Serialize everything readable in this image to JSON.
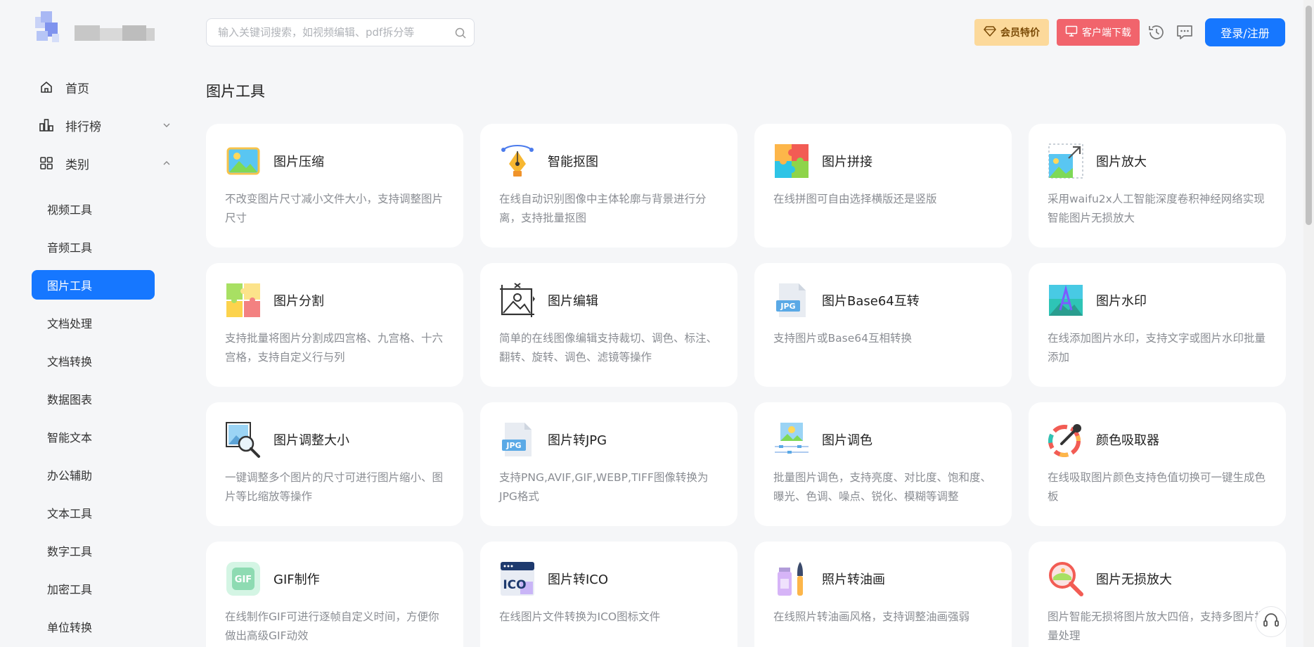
{
  "sidebar": {
    "nav": [
      {
        "label": "首页",
        "icon": "home-icon"
      },
      {
        "label": "排行榜",
        "icon": "ranking-icon"
      },
      {
        "label": "类别",
        "icon": "category-icon"
      }
    ],
    "categories": [
      "视频工具",
      "音频工具",
      "图片工具",
      "文档处理",
      "文档转换",
      "数据图表",
      "智能文本",
      "办公辅助",
      "文本工具",
      "数字工具",
      "加密工具",
      "单位转换"
    ],
    "active_category": "图片工具"
  },
  "header": {
    "search_placeholder": "输入关键词搜索，如视频编辑、pdf拆分等",
    "vip_label": "会员特价",
    "client_label": "客户端下载",
    "login_label": "登录/注册"
  },
  "page_title": "图片工具",
  "tools": [
    {
      "title": "图片压缩",
      "desc": "不改变图片尺寸减小文件大小，支持调整图片尺寸",
      "icon": "image-compress-icon"
    },
    {
      "title": "智能抠图",
      "desc": "在线自动识别图像中主体轮廓与背景进行分离，支持批量抠图",
      "icon": "pen-tool-icon"
    },
    {
      "title": "图片拼接",
      "desc": "在线拼图可自由选择横版还是竖版",
      "icon": "puzzle-icon"
    },
    {
      "title": "图片放大",
      "desc": "采用waifu2x人工智能深度卷积神经网络实现智能图片无损放大",
      "icon": "image-enlarge-icon"
    },
    {
      "title": "图片分割",
      "desc": "支持批量将图片分割成四宫格、九宫格、十六宫格，支持自定义行与列",
      "icon": "image-split-icon"
    },
    {
      "title": "图片编辑",
      "desc": "简单的在线图像编辑支持裁切、调色、标注、翻转、旋转、调色、滤镜等操作",
      "icon": "image-edit-icon"
    },
    {
      "title": "图片Base64互转",
      "desc": "支持图片或Base64互相转换",
      "icon": "jpg-file-icon"
    },
    {
      "title": "图片水印",
      "desc": "在线添加图片水印，支持文字或图片水印批量添加",
      "icon": "watermark-icon"
    },
    {
      "title": "图片调整大小",
      "desc": "一键调整多个图片的尺寸可进行图片缩小、图片等比缩放等操作",
      "icon": "image-resize-icon"
    },
    {
      "title": "图片转JPG",
      "desc": "支持PNG,AVIF,GIF,WEBP,TIFF图像转换为JPG格式",
      "icon": "jpg-convert-icon"
    },
    {
      "title": "图片调色",
      "desc": "批量图片调色，支持亮度、对比度、饱和度、曝光、色调、噪点、锐化、模糊等调整",
      "icon": "color-adjust-icon"
    },
    {
      "title": "颜色吸取器",
      "desc": "在线吸取图片颜色支持色值切换可一键生成色板",
      "icon": "color-picker-icon"
    },
    {
      "title": "GIF制作",
      "desc": "在线制作GIF可进行逐帧自定义时间，方便你做出高级GIF动效",
      "icon": "gif-icon"
    },
    {
      "title": "图片转ICO",
      "desc": "在线图片文件转换为ICO图标文件",
      "icon": "ico-icon"
    },
    {
      "title": "照片转油画",
      "desc": "在线照片转油画风格，支持调整油画强弱",
      "icon": "paint-brush-icon"
    },
    {
      "title": "图片无损放大",
      "desc": "图片智能无损将图片放大四倍，支持多图片批量处理",
      "icon": "magnifier-icon"
    }
  ],
  "ico_badge": "ICO",
  "jpg_badge": "JPG",
  "gif_badge": "GIF",
  "colors": {
    "accent": "#1677ff",
    "vip_bg": "#fcd99b",
    "client_bg": "#f1646c"
  }
}
